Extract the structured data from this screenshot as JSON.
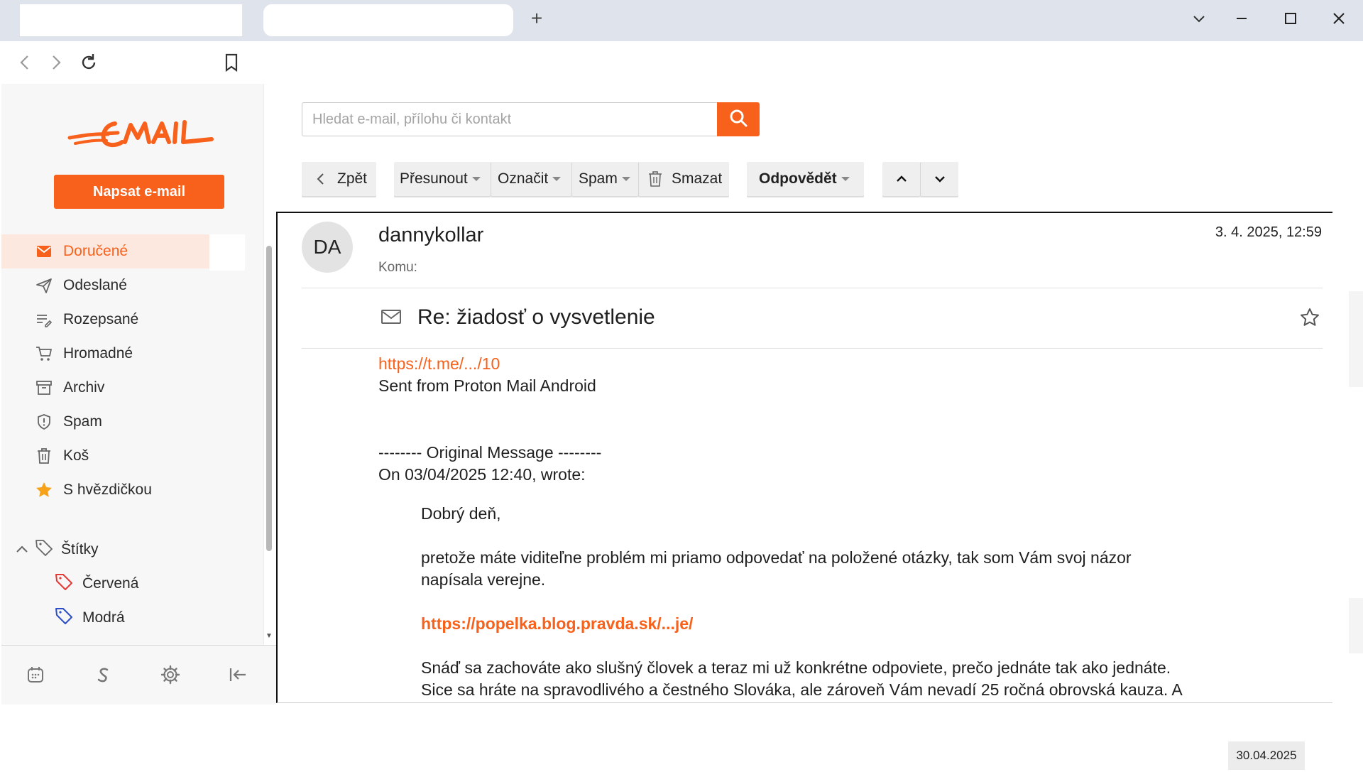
{
  "browser": {
    "new_tab_symbol": "+"
  },
  "search": {
    "placeholder": "Hledat e-mail, přílohu či kontakt"
  },
  "sidebar": {
    "compose_label": "Napsat e-mail",
    "folders": [
      {
        "label": "Doručené",
        "icon": "inbox-icon",
        "active": true
      },
      {
        "label": "Odeslané",
        "icon": "send-icon"
      },
      {
        "label": "Rozepsané",
        "icon": "drafts-icon"
      },
      {
        "label": "Hromadné",
        "icon": "cart-icon"
      },
      {
        "label": "Archiv",
        "icon": "archive-icon"
      },
      {
        "label": "Spam",
        "icon": "shield-icon"
      },
      {
        "label": "Koš",
        "icon": "trash-icon"
      },
      {
        "label": "S hvězdičkou",
        "icon": "star-icon"
      }
    ],
    "labels_title": "Štítky",
    "labels": [
      {
        "label": "Červená",
        "color": "#e53935"
      },
      {
        "label": "Modrá",
        "color": "#2c4fc9"
      }
    ]
  },
  "toolbar": {
    "back_label": "Zpět",
    "move_label": "Přesunout",
    "mark_label": "Označit",
    "spam_label": "Spam",
    "delete_label": "Smazat",
    "reply_label": "Odpovědět"
  },
  "message": {
    "avatar_initials": "DA",
    "sender": "dannykollar",
    "to_label": "Komu:",
    "date": "3. 4. 2025, 12:59",
    "subject": "Re: žiadosť o vysvetlenie",
    "link1": "https://t.me/.../10",
    "line_sent": "Sent from Proton Mail Android",
    "line_original": "-------- Original Message --------",
    "line_on": "On 03/04/2025 12:40, wrote:",
    "quote_greeting": "Dobrý deň,",
    "quote_p1_l1": "pretože máte viditeľne problém mi priamo odpovedať na položené otázky, tak som Vám svoj názor",
    "quote_p1_l2": "napísala verejne.",
    "quote_link": "https://popelka.blog.pravda.sk/...je/",
    "quote_p2_l1": "Snáď sa zachováte ako slušný človek a teraz mi už konkrétne odpoviete, prečo jednáte tak ako jednáte.",
    "quote_p2_l2": "Sice sa hráte na spravodlivého a čestného Slováka, ale zároveň Vám nevadí 25 ročná obrovská kauza. A"
  },
  "taskbar": {
    "date": "30.04.2025"
  },
  "colors": {
    "accent": "#f8611b",
    "active_bg": "#fde8df",
    "star": "#f7a21b"
  }
}
